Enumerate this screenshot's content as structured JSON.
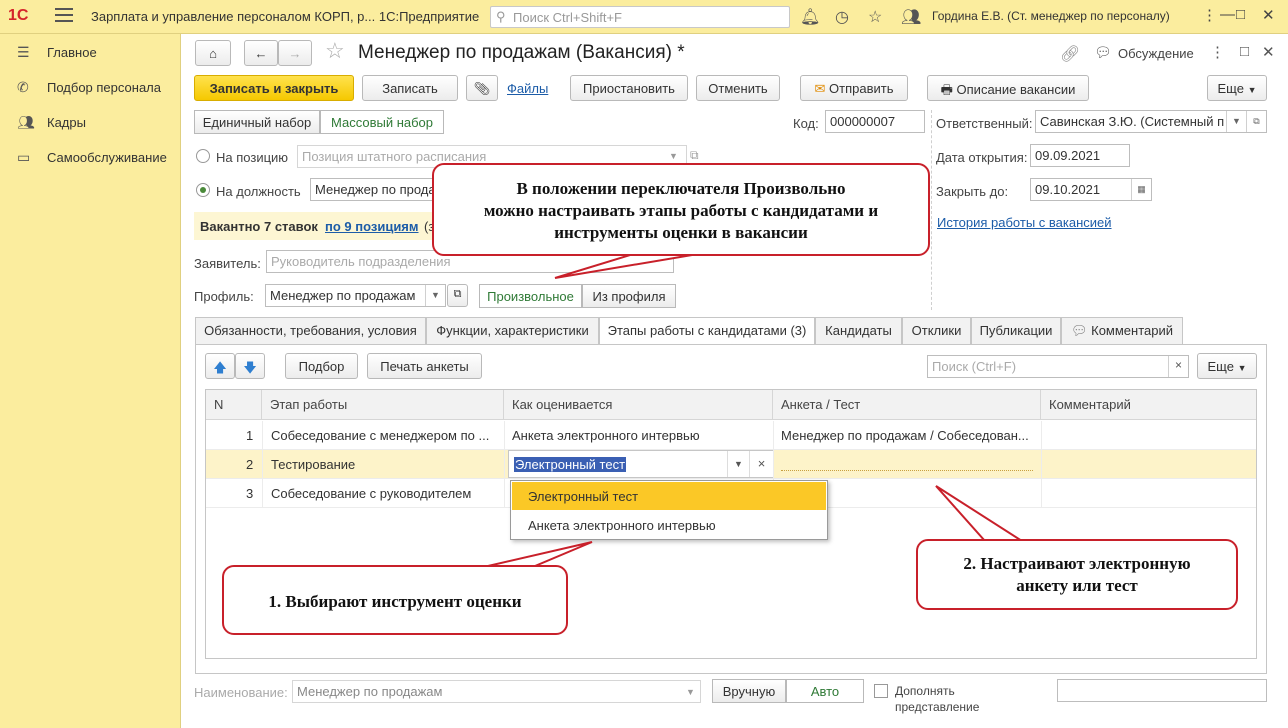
{
  "titlebar": {
    "logo": "1С",
    "app_title": "Зарплата и управление персоналом КОРП, р...   1С:Предприятие",
    "search_placeholder": "Поиск Ctrl+Shift+F",
    "user": "Гордина Е.В. (Ст. менеджер по персоналу)"
  },
  "sidebar": {
    "items": [
      {
        "label": "Главное",
        "icon": "menu-icon"
      },
      {
        "label": "Подбор персонала",
        "icon": "phone-icon"
      },
      {
        "label": "Кадры",
        "icon": "people-icon"
      },
      {
        "label": "Самообслуживание",
        "icon": "monitor-icon"
      }
    ]
  },
  "form": {
    "title": "Менеджер по продажам (Вакансия) *",
    "discussion": "Обсуждение",
    "toolbar": {
      "save_close": "Записать и закрыть",
      "save": "Записать",
      "files": "Файлы",
      "suspend": "Приостановить",
      "cancel": "Отменить",
      "send": "Отправить",
      "description": "Описание вакансии",
      "more": "Еще"
    },
    "mode": {
      "single": "Единичный набор",
      "mass": "Массовый набор"
    },
    "code_label": "Код:",
    "code_value": "000000007",
    "responsible_label": "Ответственный:",
    "responsible_value": "Савинская З.Ю. (Системный п",
    "position_radio": "На позицию",
    "position_placeholder": "Позиция штатного расписания",
    "job_radio": "На должность",
    "job_value": "Менеджер по прода",
    "open_date_label": "Дата открытия:",
    "open_date_value": "09.09.2021",
    "close_label": "Закрыть до:",
    "close_value": "09.10.2021",
    "history_link": "История работы с вакансией",
    "vacancy_text": "Вакантно 7 ставок",
    "vacancy_link": "по 9 позициям",
    "vacancy_tail": "(з",
    "requester_label": "Заявитель:",
    "requester_placeholder": "Руководитель подразделения",
    "profile_label": "Профиль:",
    "profile_value": "Менеджер по продажам",
    "profile_mode": {
      "free": "Произвольное",
      "from_profile": "Из профиля"
    },
    "tabs": [
      "Обязанности, требования, условия",
      "Функции, характеристики",
      "Этапы работы с кандидатами (3)",
      "Кандидаты",
      "Отклики",
      "Публикации",
      "Комментарий"
    ],
    "table_toolbar": {
      "select": "Подбор",
      "print": "Печать анкеты",
      "search_placeholder": "Поиск (Ctrl+F)",
      "more": "Еще"
    },
    "table": {
      "headers": [
        "N",
        "Этап работы",
        "Как оценивается",
        "Анкета / Тест",
        "Комментарий"
      ],
      "rows": [
        [
          "1",
          "Собеседование с менеджером по ...",
          "Анкета электронного интервью",
          "Менеджер по продажам / Собеседован...",
          ""
        ],
        [
          "2",
          "Тестирование",
          "Электронный тест",
          "",
          ""
        ],
        [
          "3",
          "Собеседование с руководителем",
          "",
          "",
          ""
        ]
      ]
    },
    "dropdown_options": [
      "Электронный тест",
      "Анкета электронного интервью"
    ],
    "bottom": {
      "name_label": "Наименование:",
      "name_value": "Менеджер по продажам",
      "manual": "Вручную",
      "auto": "Авто",
      "extend_label": "Дополнять",
      "extend_label2": "представление"
    }
  },
  "callouts": {
    "top": [
      "В положении переключателя Произвольно",
      "можно настраивать этапы работы с кандидатами и",
      "инструменты оценки в вакансии"
    ],
    "one": "1. Выбирают инструмент оценки",
    "two": [
      "2. Настраивают электронную",
      "анкету или тест"
    ]
  },
  "colors": {
    "accent_yellow": "#fbed9e",
    "primary_button": "#f5c800",
    "callout_border": "#c8202a",
    "selection": "#fbc826"
  }
}
